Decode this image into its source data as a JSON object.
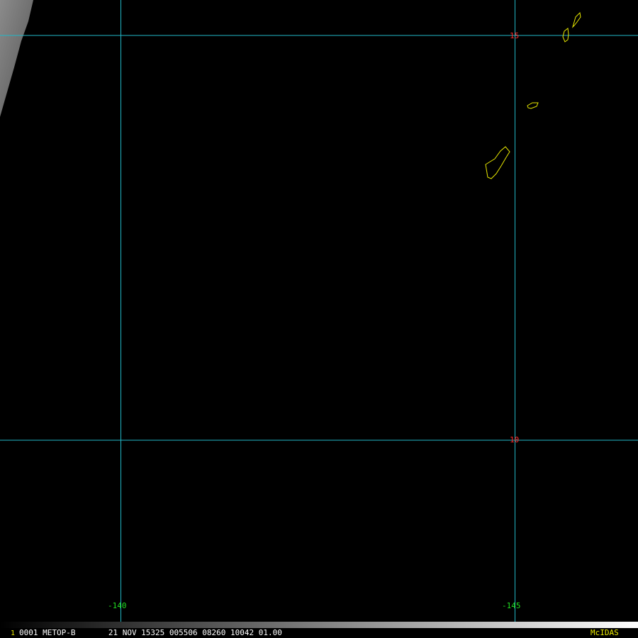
{
  "image": {
    "satellite": "METOP-B",
    "frame_index": "1",
    "status_line": "0001 METOP-B       21 NOV 15325 005506 08260 10042 01.00",
    "software_label": "McIDAS"
  },
  "grid": {
    "latitude_labels": [
      "15",
      "10"
    ],
    "longitude_labels": [
      "-140",
      "-145"
    ]
  },
  "colors": {
    "background": "#000000",
    "grid_lines": "#22b8c8",
    "coastline": "#e8e800",
    "latitude_label": "#ff2a2a",
    "longitude_label": "#22dd22",
    "cloud_swath": "#8a8a8a"
  },
  "features": {
    "land": [
      "island-outline",
      "island-outline",
      "island-outline",
      "island-outline"
    ],
    "cloud": "cloud-swath"
  }
}
